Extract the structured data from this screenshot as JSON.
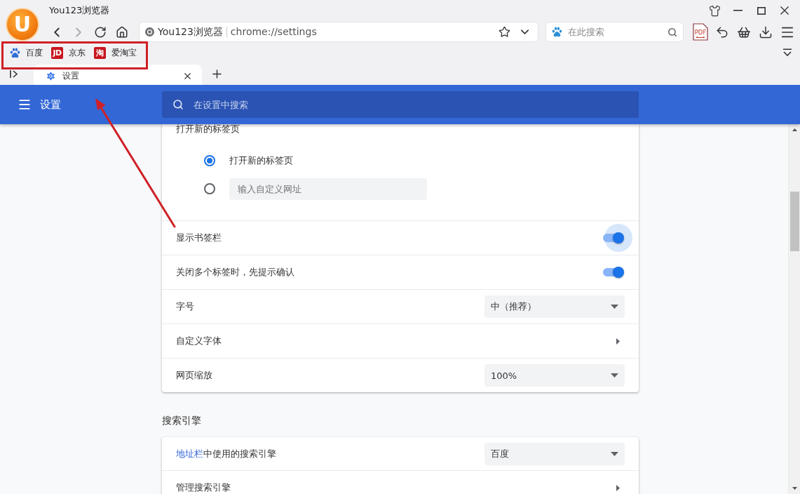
{
  "window": {
    "logo": "U",
    "title": "You123浏览器"
  },
  "toolbar": {
    "forward_disabled": true,
    "address": {
      "site": "You123浏览器",
      "url": "chrome://settings"
    },
    "search": {
      "placeholder": "在此搜索"
    },
    "pdf_icon_label": "PDF"
  },
  "bookmarks": [
    {
      "kind": "paw",
      "label": "百度"
    },
    {
      "kind": "badge",
      "badge": "JD",
      "label": "京东"
    },
    {
      "kind": "badge",
      "badge": "淘",
      "label": "爱淘宝"
    }
  ],
  "tabs": [
    {
      "label": "设置",
      "selected": true
    }
  ],
  "settings_header": {
    "title": "设置",
    "search_placeholder": "在设置中搜索"
  },
  "startup": {
    "heading": "打开新的标签页",
    "options": [
      {
        "kind": "choice",
        "label": "打开新的标签页",
        "selected": true
      },
      {
        "kind": "custom_url",
        "placeholder": "输入自定义网址",
        "selected": false
      }
    ]
  },
  "appearance_rows": [
    {
      "kind": "toggle",
      "label": "显示书签栏",
      "on": true,
      "focused": true
    },
    {
      "kind": "toggle",
      "label": "关闭多个标签时，先提示确认",
      "on": true,
      "focused": false
    },
    {
      "kind": "select",
      "label": "字号",
      "value": "中（推荐）"
    },
    {
      "kind": "link",
      "label": "自定义字体"
    },
    {
      "kind": "select",
      "label": "网页缩放",
      "value": "100%"
    }
  ],
  "search_engine": {
    "heading": "搜索引擎",
    "rows": [
      {
        "kind": "select",
        "link": "地址栏",
        "label": "中使用的搜索引擎",
        "value": "百度"
      },
      {
        "kind": "link",
        "label": "管理搜索引擎"
      }
    ]
  }
}
